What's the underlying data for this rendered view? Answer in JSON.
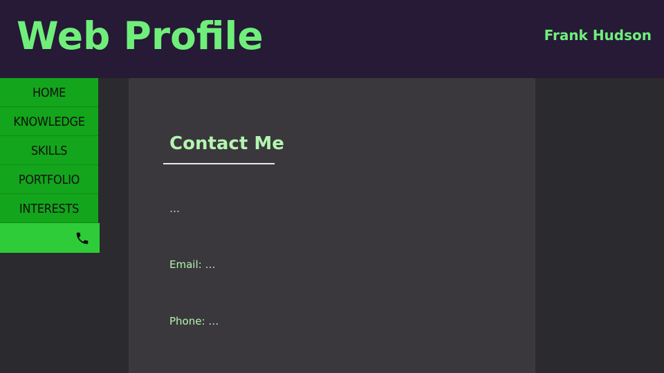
{
  "header": {
    "title": "Web Profile",
    "user_name": "Frank Hudson"
  },
  "sidebar": {
    "items": [
      {
        "label": "HOME"
      },
      {
        "label": "KNOWLEDGE"
      },
      {
        "label": "SKILLS"
      },
      {
        "label": "PORTFOLIO"
      },
      {
        "label": "INTERESTS"
      },
      {
        "label": "",
        "icon": "phone-icon",
        "active": true
      }
    ]
  },
  "main": {
    "heading": "Contact Me",
    "intro": "…",
    "email": "Email: …",
    "phone": "Phone: …"
  },
  "colors": {
    "header_bg": "#261a37",
    "accent_green": "#6fef7a",
    "nav_green": "#13a51b",
    "nav_active": "#2ecc38",
    "panel_bg": "#3a383d",
    "page_bg": "#2b2a2e",
    "text_light_green": "#b4f5b0"
  }
}
